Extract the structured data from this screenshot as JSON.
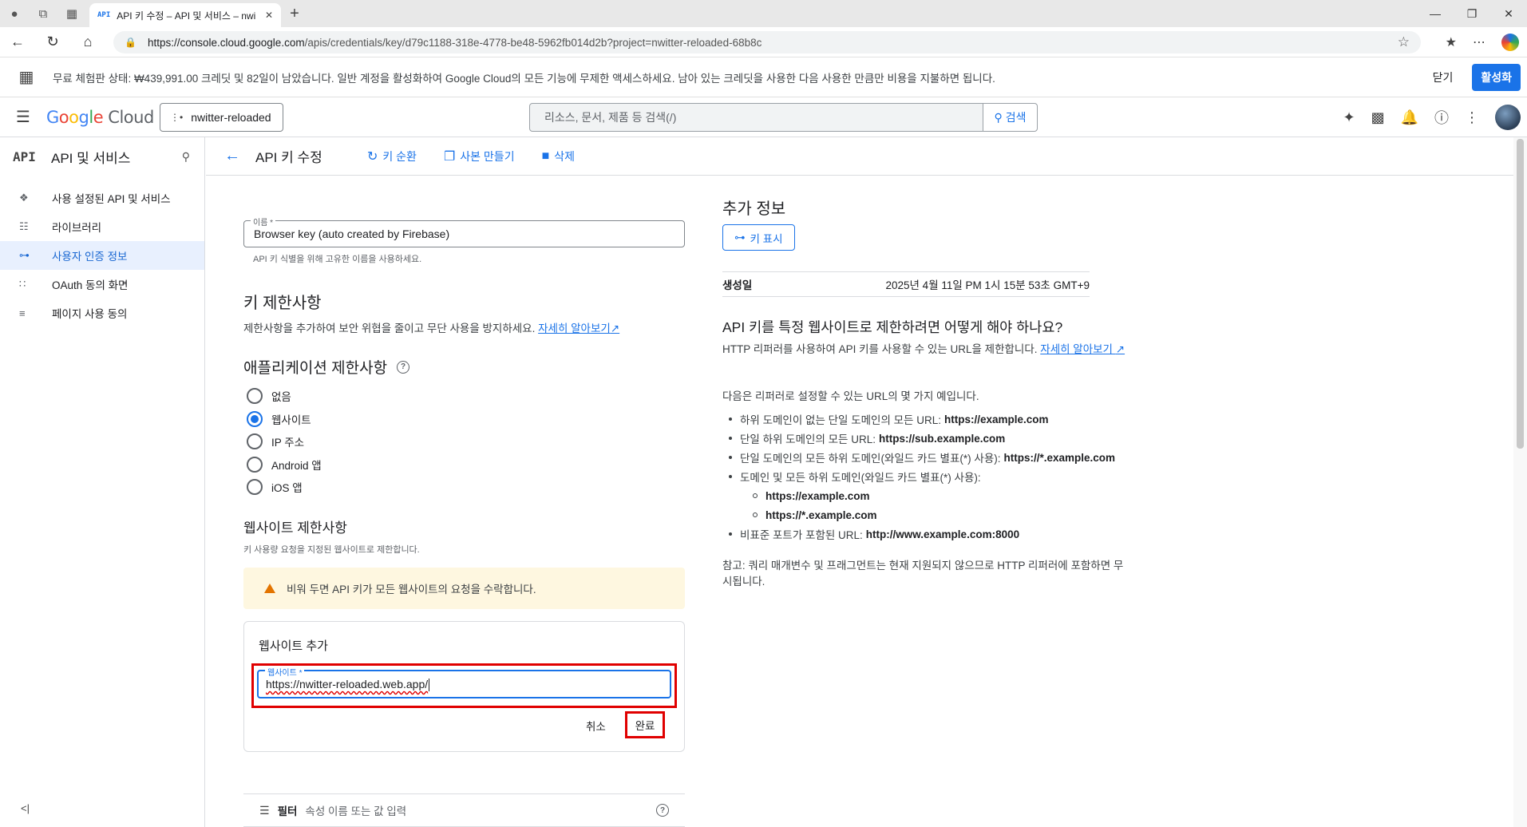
{
  "browser": {
    "tab_favicon": "API",
    "tab_title": "API 키 수정 – API 및 서비스 – nwi",
    "url_domain": "https://console.cloud.google.com",
    "url_path": "/apis/credentials/key/d79c1188-318e-4778-be48-5962fb014d2b?project=nwitter-reloaded-68b8c"
  },
  "banner": {
    "text": "무료 체험판 상태: ₩439,991.00 크레딧 및 82일이 남았습니다. 일반 계정을 활성화하여 Google Cloud의 모든 기능에 무제한 액세스하세요. 남아 있는 크레딧을 사용한 다음 사용한 만큼만 비용을 지불하면 됩니다.",
    "close_label": "닫기",
    "activate_label": "활성화"
  },
  "header": {
    "logo_google": [
      "G",
      "o",
      "o",
      "g",
      "l",
      "e"
    ],
    "logo_cloud": "Cloud",
    "project": "nwitter-reloaded",
    "search_placeholder": "리소스, 문서, 제품 등 검색(/)",
    "search_button": "검색"
  },
  "sidebar": {
    "badge": "API",
    "title": "API 및 서비스",
    "items": [
      {
        "label": "사용 설정된 API 및 서비스",
        "icon": "diamond-move-icon"
      },
      {
        "label": "라이브러리",
        "icon": "library-icon"
      },
      {
        "label": "사용자 인증 정보",
        "icon": "key-icon",
        "active": true
      },
      {
        "label": "OAuth 동의 화면",
        "icon": "oauth-icon"
      },
      {
        "label": "페이지 사용 동의",
        "icon": "settings-list-icon"
      }
    ]
  },
  "toolbar": {
    "title": "API 키 수정",
    "rotate": "키 순환",
    "copy": "사본 만들기",
    "delete": "삭제"
  },
  "form": {
    "name_label": "이름 *",
    "name_value": "Browser key (auto created by Firebase)",
    "name_hint": "API 키 식별을 위해 고유한 이름을 사용하세요.",
    "key_restrictions_title": "키 제한사항",
    "key_restrictions_desc": "제한사항을 추가하여 보안 위협을 줄이고 무단 사용을 방지하세요.",
    "learn_more": "자세히 알아보기",
    "app_restrictions_title": "애플리케이션 제한사항",
    "radio_options": [
      "없음",
      "웹사이트",
      "IP 주소",
      "Android 앱",
      "iOS 앱"
    ],
    "radio_selected": 1,
    "website_restrictions_title": "웹사이트 제한사항",
    "website_restrictions_desc": "키 사용량 요청을 지정된 웹사이트로 제한합니다.",
    "warning": "비워 두면 API 키가 모든 웹사이트의 요청을 수락합니다.",
    "add_website_title": "웹사이트 추가",
    "website_label": "웹사이트 *",
    "website_value": "https://nwitter-reloaded.web.app/",
    "cancel": "취소",
    "done": "완료",
    "filter_label": "필터",
    "filter_placeholder": "속성 이름 또는 값 입력"
  },
  "info": {
    "title": "추가 정보",
    "show_key": "키 표시",
    "created_label": "생성일",
    "created_value": "2025년 4월 11일 PM 1시 15분 53초 GMT+9",
    "how_title": "API 키를 특정 웹사이트로 제한하려면 어떻게 해야 하나요?",
    "how_desc": "HTTP 리퍼러를 사용하여 API 키를 사용할 수 있는 URL을 제한합니다.",
    "learn_more": "자세히 알아보기",
    "examples_intro": "다음은 리퍼러로 설정할 수 있는 URL의 몇 가지 예입니다.",
    "examples": [
      {
        "text": "하위 도메인이 없는 단일 도메인의 모든 URL:",
        "url": "https://example.com"
      },
      {
        "text": "단일 하위 도메인의 모든 URL:",
        "url": "https://sub.example.com"
      },
      {
        "text": "단일 도메인의 모든 하위 도메인(와일드 카드 별표(*) 사용):",
        "url": "https://*.example.com"
      },
      {
        "text": "도메인 및 모든 하위 도메인(와일드 카드 별표(*) 사용):",
        "url": ""
      }
    ],
    "sub_examples": [
      "https://example.com",
      "https://*.example.com"
    ],
    "last_example": {
      "text": "비표준 포트가 포함된 URL:",
      "url": "http://www.example.com:8000"
    },
    "note": "참고: 쿼리 매개변수 및 프래그먼트는 현재 지원되지 않으므로 HTTP 리퍼러에 포함하면 무시됩니다."
  }
}
